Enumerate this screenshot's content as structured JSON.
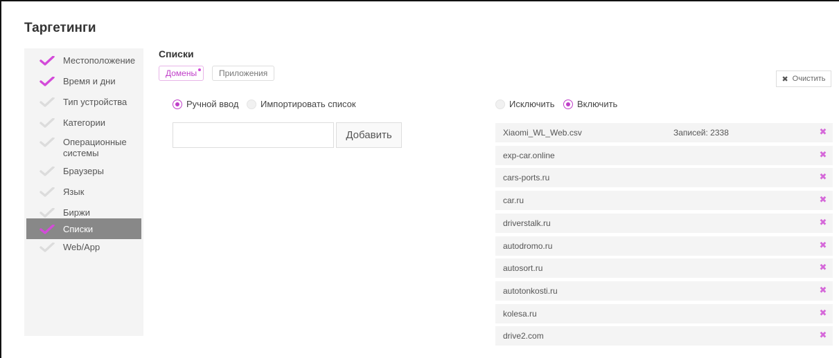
{
  "page": {
    "title": "Таргетинги"
  },
  "colors": {
    "accent": "#c03fc9",
    "check_on": "#d34bd9",
    "check_off": "#dcdcdc",
    "delete": "#d568d9"
  },
  "sidebar": {
    "items": [
      {
        "label": "Местоположение",
        "checked": true,
        "active": false
      },
      {
        "label": "Время и дни",
        "checked": true,
        "active": false
      },
      {
        "label": "Тип устройства",
        "checked": false,
        "active": false
      },
      {
        "label": "Категории",
        "checked": false,
        "active": false
      },
      {
        "label": "Операционные системы",
        "checked": false,
        "active": false
      },
      {
        "label": "Браузеры",
        "checked": false,
        "active": false
      },
      {
        "label": "Язык",
        "checked": false,
        "active": false
      },
      {
        "label": "Биржи",
        "checked": false,
        "active": false
      },
      {
        "label": "Списки",
        "checked": true,
        "active": true
      },
      {
        "label": "Web/App",
        "checked": false,
        "active": false
      }
    ]
  },
  "main": {
    "section_title": "Списки",
    "tabs": [
      {
        "label": "Домены",
        "active": true
      },
      {
        "label": "Приложения",
        "active": false
      }
    ],
    "input_mode": {
      "manual_label": "Ручной ввод",
      "import_label": "Импортировать список",
      "selected": "manual"
    },
    "domain_input": {
      "value": "",
      "placeholder": ""
    },
    "add_label": "Добавить",
    "clear_label": "Очистить",
    "filter_mode": {
      "exclude_label": "Исключить",
      "include_label": "Включить",
      "selected": "include"
    },
    "list": [
      {
        "name": "Xiaomi_WL_Web.csv",
        "count": "Записей: 2338"
      },
      {
        "name": "exp-car.online",
        "count": ""
      },
      {
        "name": "cars-ports.ru",
        "count": ""
      },
      {
        "name": "car.ru",
        "count": ""
      },
      {
        "name": "driverstalk.ru",
        "count": ""
      },
      {
        "name": "autodromo.ru",
        "count": ""
      },
      {
        "name": "autosort.ru",
        "count": ""
      },
      {
        "name": "autotonkosti.ru",
        "count": ""
      },
      {
        "name": "kolesa.ru",
        "count": ""
      },
      {
        "name": "drive2.com",
        "count": ""
      }
    ]
  }
}
